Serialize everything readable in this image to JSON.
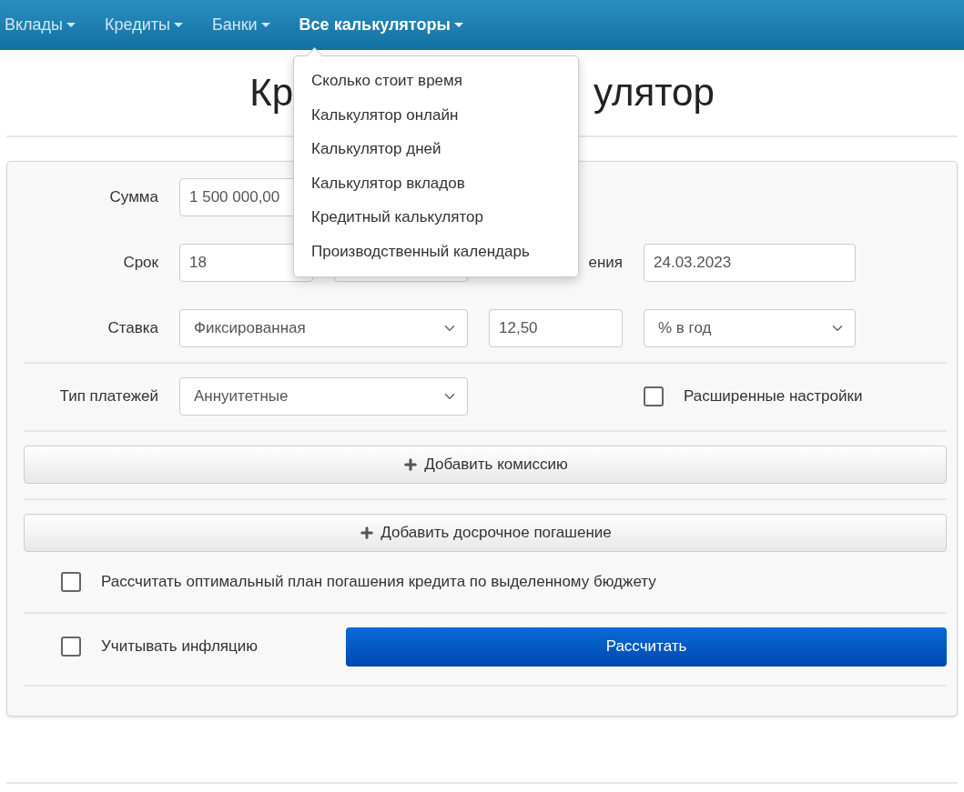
{
  "nav": [
    {
      "label": "Вклады",
      "selected": false
    },
    {
      "label": "Кредиты",
      "selected": false
    },
    {
      "label": "Банки",
      "selected": false
    },
    {
      "label": "Все калькуляторы",
      "selected": true
    }
  ],
  "menu": {
    "items": [
      "Сколько стоит время",
      "Калькулятор онлайн",
      "Калькулятор дней",
      "Калькулятор вкладов",
      "Кредитный калькулятор",
      "Производственный календарь"
    ]
  },
  "title_parts": [
    "Кр",
    "улятор"
  ],
  "form": {
    "amount": {
      "label": "Сумма",
      "value": "1 500 000,00"
    },
    "term": {
      "label": "Срок",
      "value": "18"
    },
    "date": {
      "label": "ения",
      "value": "24.03.2023"
    },
    "rate": {
      "label": "Ставка",
      "type": "Фиксированная",
      "value": "12,50",
      "unit": "% в год"
    },
    "payment": {
      "label": "Тип платежей",
      "value": "Аннуитетные"
    },
    "advanced": {
      "label": "Расширенные настройки",
      "checked": false
    }
  },
  "add_buttons": [
    "Добавить комиссию",
    "Добавить досрочное погашение"
  ],
  "optimal": {
    "label": "Рассчитать оптимальный план погашения кредита по выделенному бюджету",
    "checked": false
  },
  "inflation": {
    "label": "Учитывать инфляцию",
    "checked": false
  },
  "calculate": "Рассчитать"
}
